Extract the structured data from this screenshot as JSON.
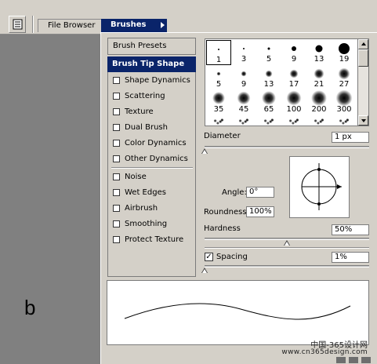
{
  "tabs": [
    {
      "label": "File Browser"
    },
    {
      "label": "Brushes"
    }
  ],
  "overlay_letter": "b",
  "sidebar": {
    "presets_label": "Brush Presets",
    "selected_label": "Brush Tip Shape",
    "options": [
      {
        "label": "Shape Dynamics",
        "checked": false
      },
      {
        "label": "Scattering",
        "checked": false
      },
      {
        "label": "Texture",
        "checked": false
      },
      {
        "label": "Dual Brush",
        "checked": false
      },
      {
        "label": "Color Dynamics",
        "checked": false
      },
      {
        "label": "Other Dynamics",
        "checked": false
      },
      {
        "label": "Noise",
        "checked": false
      },
      {
        "label": "Wet Edges",
        "checked": false
      },
      {
        "label": "Airbrush",
        "checked": false
      },
      {
        "label": "Smoothing",
        "checked": false
      },
      {
        "label": "Protect Texture",
        "checked": false
      }
    ]
  },
  "brush_grid": {
    "sizes": [
      "1",
      "3",
      "5",
      "9",
      "13",
      "19",
      "5",
      "9",
      "13",
      "17",
      "21",
      "27",
      "35",
      "45",
      "65",
      "100",
      "200",
      "300"
    ],
    "selected_index": 0
  },
  "diameter": {
    "label": "Diameter",
    "value": "1 px",
    "slider_fraction": 0.0
  },
  "angle": {
    "label": "Angle:",
    "value": "0°"
  },
  "roundness": {
    "label": "Roundness:",
    "value": "100%"
  },
  "hardness": {
    "label": "Hardness",
    "value": "50%",
    "slider_fraction": 0.5
  },
  "spacing": {
    "label": "Spacing",
    "value": "1%",
    "checked": true,
    "slider_fraction": 0.0
  },
  "watermark": {
    "line1": "中国-365设计网",
    "line2": "www.cn365design.com"
  },
  "colors": {
    "selection": "#0a246a",
    "panel": "#d4d0c8",
    "background": "#808080"
  }
}
